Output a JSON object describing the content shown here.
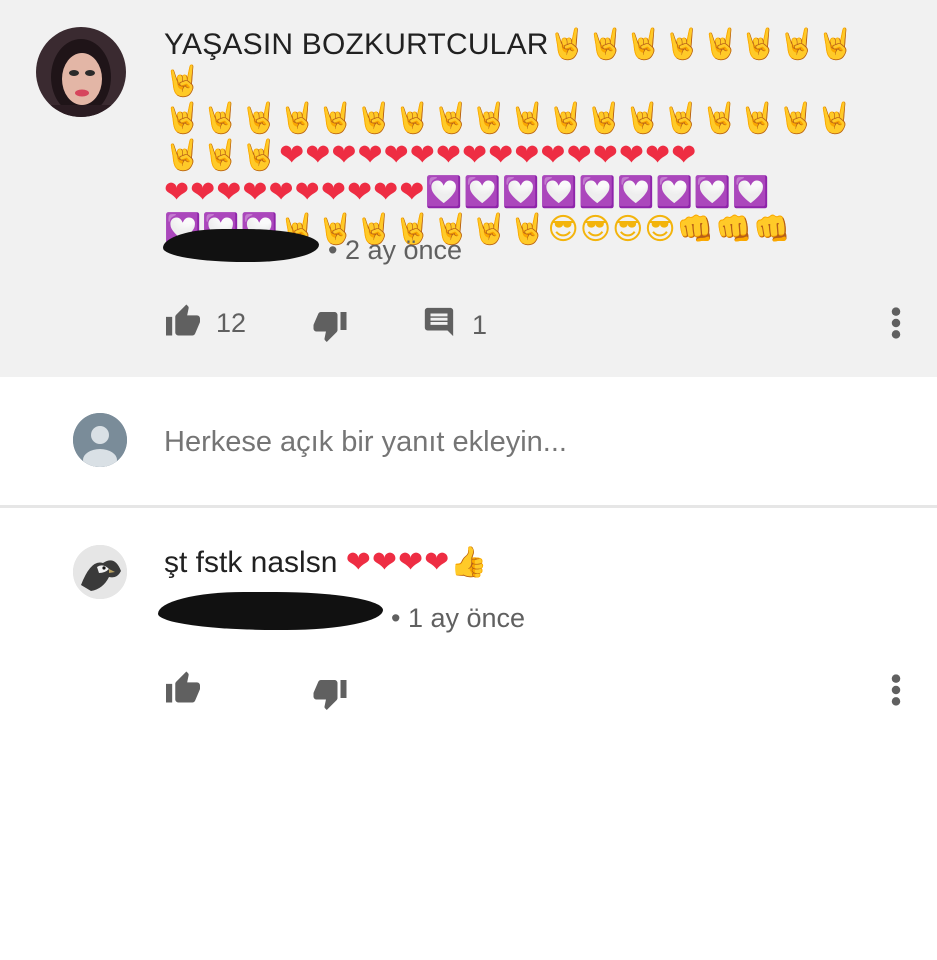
{
  "comment": {
    "text_main": "YAŞASIN  BOZKURTCULAR",
    "emoji_line1": "🤘🤘🤘🤘🤘🤘🤘🤘🤘",
    "emoji_line2": "🤘🤘🤘🤘🤘🤘🤘🤘🤘🤘🤘🤘🤘🤘🤘🤘🤘🤘",
    "emoji_line3_horns": "🤘🤘🤘",
    "emoji_line3_hearts": "❤❤❤❤❤❤❤❤❤❤❤❤❤❤❤❤",
    "emoji_line4_hearts": "❤❤❤❤❤❤❤❤❤❤",
    "emoji_line4_pink": "💟💟💟💟💟💟💟💟💟",
    "emoji_line5_pink": "💟💟💟",
    "emoji_line5_horns": "🤘🤘🤘🤘🤘🤘🤘",
    "emoji_line5_cool": "😎😎😎😎",
    "emoji_line5_fists": "👊👊👊",
    "time": "• 2 ay önce",
    "like_count": "12",
    "reply_count": "1"
  },
  "reply_box": {
    "placeholder": "Herkese açık bir yanıt ekleyin..."
  },
  "reply": {
    "text": "şt fstk naslsn",
    "hearts": "❤❤❤❤",
    "thumb": "👍",
    "time": "• 1 ay önce"
  },
  "icons": {
    "like": "thumb-up-icon",
    "dislike": "thumb-down-icon",
    "reply": "comment-icon",
    "menu": "more-vert-icon"
  },
  "colors": {
    "comment_bg": "#f1f1f1",
    "icon_gray": "#606060",
    "text": "#212121"
  }
}
